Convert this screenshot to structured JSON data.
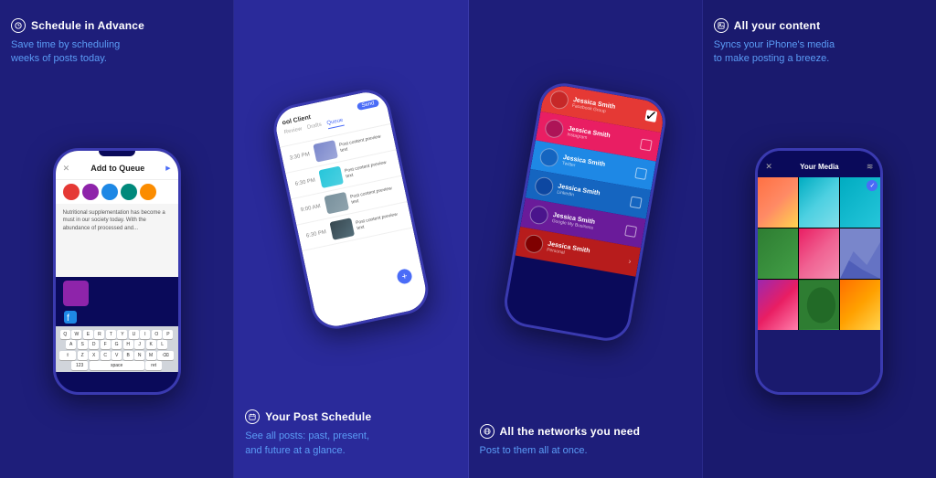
{
  "panels": [
    {
      "id": "panel-1",
      "icon": "clock-icon",
      "icon_symbol": "⏰",
      "title": "Schedule in Advance",
      "description": "Save time by scheduling\nweeks of posts today.",
      "phone": {
        "header_title": "Add to Queue",
        "close": "✕",
        "send": "▶",
        "avatars": [
          "#e53935",
          "#8e24aa",
          "#1e88e5",
          "#00897b",
          "#fb8c00"
        ],
        "content_text": "Nutritional supplementation has become a must in our society today. With the abundance of processed and...",
        "image_bg": "#8e24aa",
        "keyboard_rows": [
          [
            "Q",
            "W",
            "E",
            "R",
            "T",
            "Y",
            "U",
            "I",
            "O",
            "P"
          ],
          [
            "A",
            "S",
            "D",
            "F",
            "G",
            "H",
            "J",
            "K",
            "L"
          ],
          [
            "⇧",
            "Z",
            "X",
            "C",
            "V",
            "B",
            "N",
            "M",
            "⌫"
          ]
        ],
        "keyboard_bottom": [
          "123",
          "space",
          "return"
        ]
      }
    },
    {
      "id": "panel-2",
      "icon": "calendar-icon",
      "icon_symbol": "📅",
      "title": "Your Post Schedule",
      "description": "See all posts: past, present,\nand future at a glance.",
      "phone": {
        "client": "ool Client",
        "tabs": [
          "Review",
          "Drafts",
          "Queue"
        ],
        "active_tab": "Queue",
        "send_label": "Send",
        "items": [
          {
            "time": "3:30 PM",
            "color": "#7986cb"
          },
          {
            "time": "6:30 PM",
            "color": "#4dd0e1"
          },
          {
            "time": "9:00 AM",
            "color": "#78909c"
          },
          {
            "time": "6:30 PM",
            "color": "#37474f"
          }
        ]
      }
    },
    {
      "id": "panel-3",
      "icon": "globe-icon",
      "icon_symbol": "🌐",
      "title": "All the networks you need",
      "description": "Post to them all at once.",
      "phone": {
        "accounts": [
          {
            "name": "Jessica Smith",
            "network": "Facebook Group",
            "color": "#e53935",
            "checked": true
          },
          {
            "name": "Jessica Smith",
            "network": "Instagram",
            "color": "#e91e63",
            "checked": false
          },
          {
            "name": "Jessica Smith",
            "network": "Twitter",
            "color": "#1e88e5",
            "checked": false
          },
          {
            "name": "Jessica Smith",
            "network": "LinkedIn",
            "color": "#1565c0",
            "checked": false
          },
          {
            "name": "Jessica Smith",
            "network": "Google My Business",
            "color": "#6a1b9a",
            "checked": false
          },
          {
            "name": "Jessica Smith",
            "network": "Personal",
            "color": "#b71c1c",
            "checked": false,
            "chevron": true
          }
        ]
      }
    },
    {
      "id": "panel-4",
      "icon": "image-icon",
      "icon_symbol": "🖼",
      "title": "All your content",
      "description": "Syncs your iPhone's media\nto make posting a breeze.",
      "phone": {
        "header_title": "Your Media",
        "media_cells": [
          {
            "class": "mc-sunset"
          },
          {
            "class": "mc-teal"
          },
          {
            "class": "mc-checked",
            "checked": true
          },
          {
            "class": "mc-green"
          },
          {
            "class": "mc-pink"
          },
          {
            "class": "mc-mountain"
          },
          {
            "class": "mc-purple-pink"
          },
          {
            "class": "mc-leaf"
          },
          {
            "class": "mc-orange"
          }
        ]
      }
    }
  ]
}
